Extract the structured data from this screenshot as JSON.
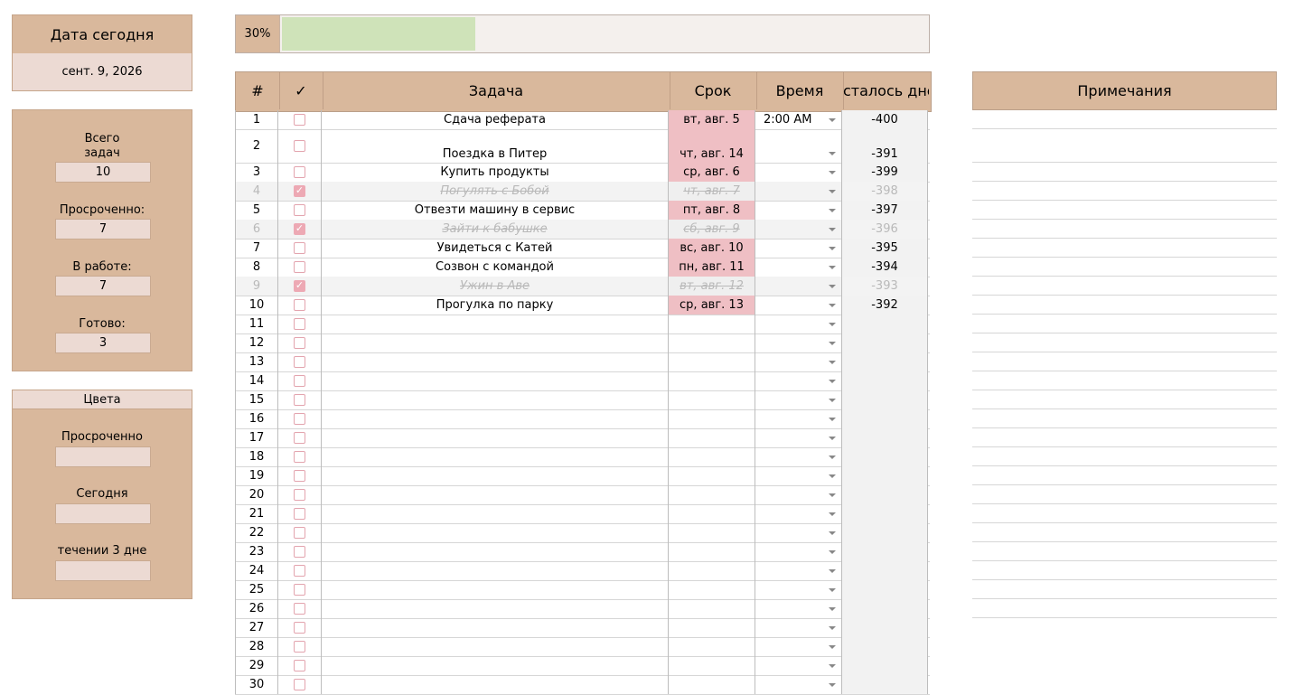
{
  "date_card": {
    "title": "Дата сегодня",
    "value": "сент. 9, 2026"
  },
  "stats": [
    {
      "label": "Всего\nзадач",
      "value": "10"
    },
    {
      "label": "Просроченно:",
      "value": "7"
    },
    {
      "label": "В работе:",
      "value": "7"
    },
    {
      "label": "Готово:",
      "value": "3"
    }
  ],
  "colors_card": {
    "title": "Цвета",
    "items": [
      "Просроченно",
      "Сегодня",
      "течении 3 дне"
    ]
  },
  "progress": {
    "label": "30%",
    "fraction": 0.3,
    "color": "#cfe3b9"
  },
  "table": {
    "headers": [
      "#",
      "✓",
      "Задача",
      "Срок",
      "Время",
      "сталось дне"
    ],
    "rows": [
      {
        "n": "1",
        "done": false,
        "task": "Сдача реферата",
        "due": "вт, авг. 5",
        "time": "2:00 AM",
        "left": "-400"
      },
      {
        "n": "2",
        "done": false,
        "task": "Поездка в Питер",
        "due": "чт, авг. 14",
        "time": "",
        "left": "-391"
      },
      {
        "n": "3",
        "done": false,
        "task": "Купить продукты",
        "due": "ср, авг. 6",
        "time": "",
        "left": "-399"
      },
      {
        "n": "4",
        "done": true,
        "task": "Погулять с Бобой",
        "due": "чт, авг. 7",
        "time": "",
        "left": "-398"
      },
      {
        "n": "5",
        "done": false,
        "task": "Отвезти машину в сервис",
        "due": "пт, авг. 8",
        "time": "",
        "left": "-397"
      },
      {
        "n": "6",
        "done": true,
        "task": "Зайти к бабушке",
        "due": "сб, авг. 9",
        "time": "",
        "left": "-396"
      },
      {
        "n": "7",
        "done": false,
        "task": "Увидеться с Катей",
        "due": "вс, авг. 10",
        "time": "",
        "left": "-395"
      },
      {
        "n": "8",
        "done": false,
        "task": "Созвон с командой",
        "due": "пн, авг. 11",
        "time": "",
        "left": "-394"
      },
      {
        "n": "9",
        "done": true,
        "task": "Ужин в Аве",
        "due": "вт, авг. 12",
        "time": "",
        "left": "-393"
      },
      {
        "n": "10",
        "done": false,
        "task": "Прогулка по парку",
        "due": "ср, авг. 13",
        "time": "",
        "left": "-392"
      },
      {
        "n": "11"
      },
      {
        "n": "12"
      },
      {
        "n": "13"
      },
      {
        "n": "14"
      },
      {
        "n": "15"
      },
      {
        "n": "16"
      },
      {
        "n": "17"
      },
      {
        "n": "18"
      },
      {
        "n": "19"
      },
      {
        "n": "20"
      },
      {
        "n": "21"
      },
      {
        "n": "22"
      },
      {
        "n": "23"
      },
      {
        "n": "24"
      },
      {
        "n": "25"
      },
      {
        "n": "26"
      },
      {
        "n": "27"
      },
      {
        "n": "28"
      },
      {
        "n": "29"
      },
      {
        "n": "30"
      }
    ]
  },
  "notes": {
    "title": "Примечания"
  },
  "colors": {
    "header": "#d9b89c",
    "overdue": "#efbfc4",
    "checkbox": "#eda9b4"
  }
}
